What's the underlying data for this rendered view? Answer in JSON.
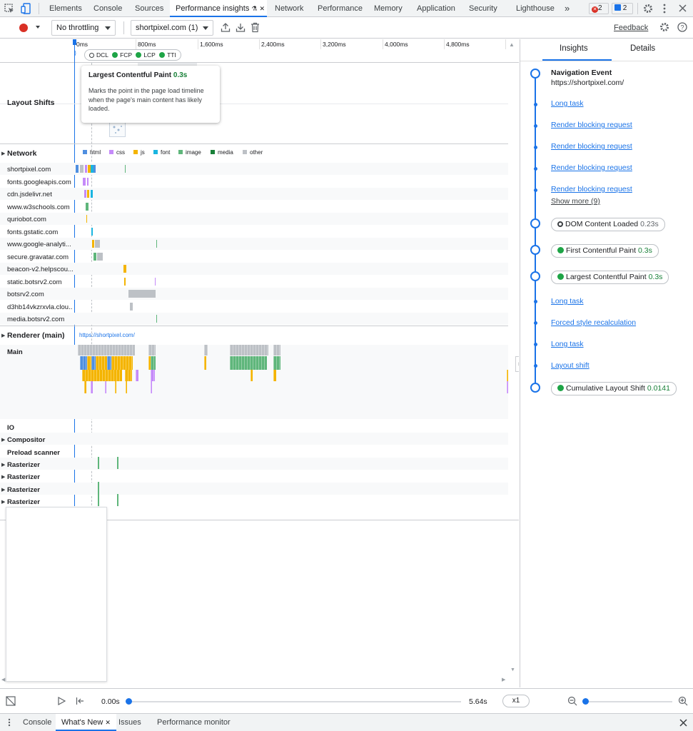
{
  "tabs": {
    "items": [
      "Elements",
      "Console",
      "Sources",
      "Performance insights",
      "Network",
      "Performance",
      "Memory",
      "Application",
      "Security",
      "Lighthouse"
    ],
    "more": "»",
    "errors_count": "2",
    "messages_count": "2",
    "close_glyph": "✕"
  },
  "toolbar": {
    "throttling": "No throttling",
    "recording": "shortpixel.com (1)",
    "feedback": "Feedback"
  },
  "ruler": {
    "ticks": [
      "0ms",
      "800ms",
      "1,600ms",
      "2,400ms",
      "3,200ms",
      "4,000ms",
      "4,800ms"
    ]
  },
  "markers": [
    "DCL",
    "FCP",
    "LCP",
    "TTI"
  ],
  "tooltip": {
    "title": "Largest Contentful Paint",
    "value": "0.3s",
    "body": "Marks the point in the page load timeline when the page's main content has likely loaded."
  },
  "tracks": {
    "layout_shifts": "Layout Shifts",
    "network": "Network",
    "renderer": "Renderer (main)",
    "renderer_url": "https://shortpixel.com/",
    "main": "Main",
    "io": "IO",
    "compositor": "Compositor",
    "preload": "Preload scanner",
    "rasterizer": "Rasterizer"
  },
  "legend": [
    {
      "label": "html",
      "color": "#4f8fe0"
    },
    {
      "label": "css",
      "color": "#c58af9"
    },
    {
      "label": "js",
      "color": "#f4b400"
    },
    {
      "label": "font",
      "color": "#1ab5e0"
    },
    {
      "label": "image",
      "color": "#5fb67b"
    },
    {
      "label": "media",
      "color": "#188038"
    },
    {
      "label": "other",
      "color": "#bdc1c6"
    }
  ],
  "domains": [
    "shortpixel.com",
    "fonts.googleapis.com",
    "cdn.jsdelivr.net",
    "www.w3schools.com",
    "quriobot.com",
    "fonts.gstatic.com",
    "www.google-analyti...",
    "secure.gravatar.com",
    "beacon-v2.helpscou...",
    "static.botsrv2.com",
    "botsrv2.com",
    "d3hb14vkzrxvla.clou...",
    "media.botsrv2.com"
  ],
  "insights": {
    "tab_insights": "Insights",
    "tab_details": "Details",
    "nav_title": "Navigation Event",
    "nav_url": "https://shortpixel.com/",
    "items": [
      {
        "type": "link",
        "label": "Long task"
      },
      {
        "type": "link",
        "label": "Render blocking request"
      },
      {
        "type": "link",
        "label": "Render blocking request"
      },
      {
        "type": "link",
        "label": "Render blocking request"
      },
      {
        "type": "link",
        "label": "Render blocking request"
      }
    ],
    "show_more": "Show more (9)",
    "dcl_label": "DOM Content Loaded",
    "dcl_value": "0.23s",
    "fcp_label": "First Contentful Paint",
    "fcp_value": "0.3s",
    "lcp_label": "Largest Contentful Paint",
    "lcp_value": "0.3s",
    "after": [
      {
        "type": "link",
        "label": "Long task"
      },
      {
        "type": "link",
        "label": "Forced style recalculation"
      },
      {
        "type": "link",
        "label": "Long task"
      },
      {
        "type": "link",
        "label": "Layout shift"
      }
    ],
    "cls_label": "Cumulative Layout Shift",
    "cls_value": "0.0141"
  },
  "playback": {
    "start": "0.00s",
    "end": "5.64s",
    "speed": "x1"
  },
  "drawer": {
    "tabs": [
      "Console",
      "What's New",
      "Issues",
      "Performance monitor"
    ]
  }
}
